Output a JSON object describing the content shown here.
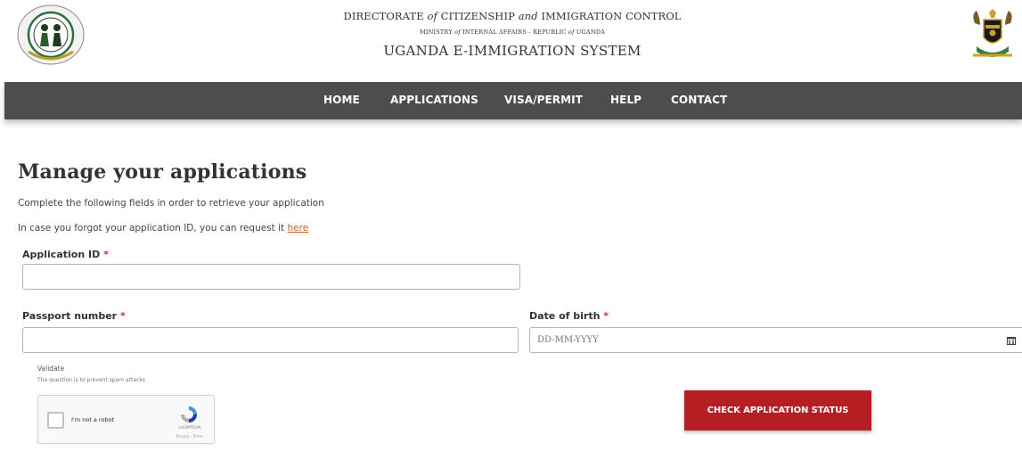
{
  "header": {
    "line1_a": "DIRECTORATE ",
    "line1_of": "of",
    "line1_b": " CITIZENSHIP ",
    "line1_and": "and",
    "line1_c": " IMMIGRATION CONTROL",
    "line2_a": "MINISTRY ",
    "line2_of1": "of",
    "line2_b": " INTERNAL AFFAIRS - REPUBLIC ",
    "line2_of2": "of",
    "line2_c": " UGANDA",
    "line3": "UGANDA E-IMMIGRATION SYSTEM",
    "left_logo_icon": "directorate-emblem-icon",
    "right_logo_icon": "uganda-coat-of-arms-icon"
  },
  "nav": {
    "items": [
      "HOME",
      "APPLICATIONS",
      "VISA/PERMIT",
      "HELP",
      "CONTACT"
    ],
    "background": "#4d4d4d"
  },
  "main": {
    "title": "Manage your applications",
    "intro1": "Complete the following fields in order to retrieve your application",
    "intro2_text": "In case you forgot your application ID, you can request it ",
    "intro2_link": "here",
    "required_mark": "*",
    "application_id_label": "Application ID",
    "application_id_value": "",
    "passport_label": "Passport number",
    "passport_value": "",
    "dob_label": "Date of birth",
    "dob_placeholder": "DD-MM-YYYY",
    "dob_icon": "calendar-icon"
  },
  "captcha": {
    "validate_label": "Validate",
    "validate_desc": "The question is to prevent spam attacks",
    "checkbox_label": "I'm not a robot",
    "brand": "reCAPTCHA",
    "terms": "Privacy - Terms"
  },
  "button": {
    "label": "CHECK APPLICATION STATUS",
    "color": "#b51f24"
  },
  "colors": {
    "link": "#c8602a",
    "required": "#c0392b"
  }
}
